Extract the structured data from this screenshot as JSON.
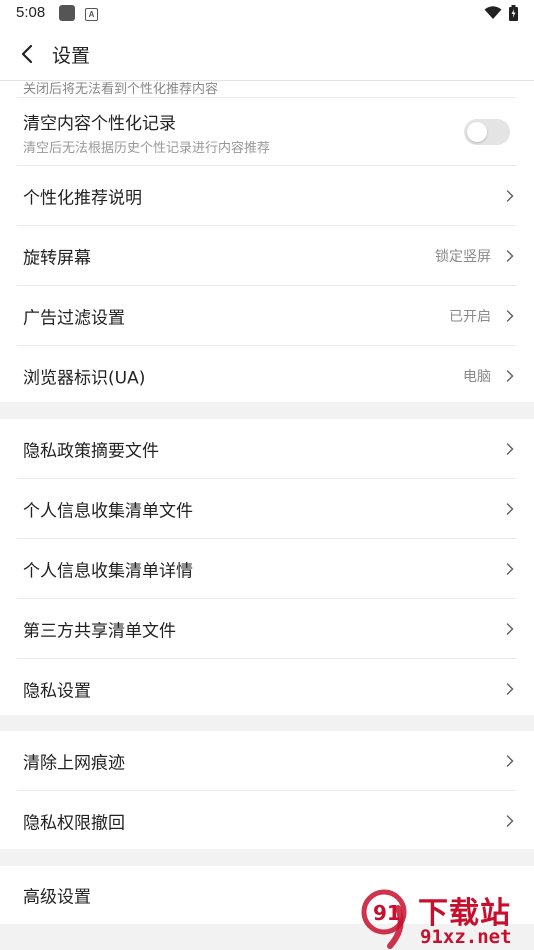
{
  "status_bar": {
    "time": "5:08",
    "icon_a": "A"
  },
  "header": {
    "title": "设置"
  },
  "group1": {
    "cut_text": "关闭后将无法看到个性化推荐内容",
    "clear_personal": {
      "label": "清空内容个性化记录",
      "sub": "清空后无法根据历史个性记录进行内容推荐",
      "toggle_on": false
    },
    "rows": [
      {
        "label": "个性化推荐说明",
        "value": ""
      },
      {
        "label": "旋转屏幕",
        "value": "锁定竖屏"
      },
      {
        "label": "广告过滤设置",
        "value": "已开启"
      },
      {
        "label": "浏览器标识(UA)",
        "value": "电脑"
      }
    ]
  },
  "group2": {
    "rows": [
      {
        "label": "隐私政策摘要文件"
      },
      {
        "label": "个人信息收集清单文件"
      },
      {
        "label": "个人信息收集清单详情"
      },
      {
        "label": "第三方共享清单文件"
      },
      {
        "label": "隐私设置"
      }
    ]
  },
  "group3": {
    "rows": [
      {
        "label": "清除上网痕迹"
      },
      {
        "label": "隐私权限撤回"
      }
    ]
  },
  "group4": {
    "rows": [
      {
        "label": "高级设置"
      }
    ]
  },
  "watermark": {
    "title": "下载站",
    "url": "91xz.net",
    "logo_text": "91"
  },
  "colors": {
    "background": "#f2f2f2",
    "card": "#ffffff",
    "watermark": "#c8102e"
  }
}
